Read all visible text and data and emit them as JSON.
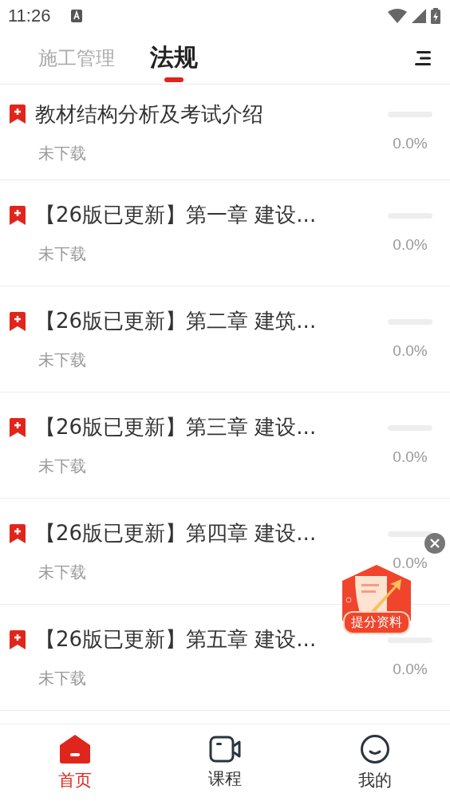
{
  "status_bar": {
    "time": "11:26"
  },
  "tabs": [
    {
      "label": "施工管理",
      "selected": false
    },
    {
      "label": "法规",
      "selected": true
    }
  ],
  "items": [
    {
      "title": "教材结构分析及考试介绍",
      "status": "未下载",
      "level": 0,
      "percent": "0.0%"
    },
    {
      "title": "【26版已更新】第一章 建设...",
      "status": "未下载",
      "level": 0,
      "percent": "0.0%"
    },
    {
      "title": "【26版已更新】第二章 建筑...",
      "status": "未下载",
      "level": 0,
      "percent": "0.0%"
    },
    {
      "title": "【26版已更新】第三章 建设...",
      "status": "未下载",
      "level": 0,
      "percent": "0.0%"
    },
    {
      "title": "【26版已更新】第四章 建设...",
      "status": "未下载",
      "level": 0,
      "percent": "0.0%"
    },
    {
      "title": "【26版已更新】第五章 建设...",
      "status": "未下载",
      "level": 0,
      "percent": "0.0%"
    }
  ],
  "promo": {
    "label": "提分资料"
  },
  "bottom_nav": [
    {
      "label": "首页",
      "kind": "home",
      "selected": true
    },
    {
      "label": "课程",
      "kind": "video",
      "selected": false
    },
    {
      "label": "我的",
      "kind": "face",
      "selected": false
    }
  ]
}
